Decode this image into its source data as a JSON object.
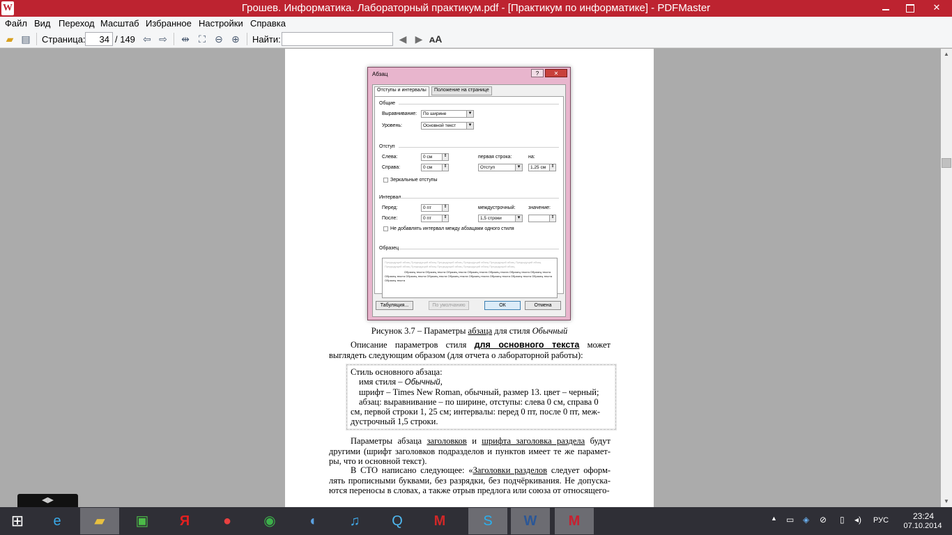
{
  "window": {
    "title": "Грошев. Информатика. Лабораторный практикум.pdf - [Практикум по информатике] - PDFMaster",
    "app_icon_glyph": "W"
  },
  "menu": [
    "Файл",
    "Вид",
    "Переход",
    "Масштаб",
    "Избранное",
    "Настройки",
    "Справка"
  ],
  "toolbar": {
    "page_label": "Страница:",
    "page_value": "34",
    "page_total": "/ 149",
    "find_label": "Найти:",
    "find_value": ""
  },
  "dialog": {
    "title": "Абзац",
    "tabs": [
      "Отступы и интервалы",
      "Положение на странице"
    ],
    "general_section": "Общие",
    "alignment_label": "Выравнивание:",
    "alignment_value": "По ширине",
    "level_label": "Уровень:",
    "level_value": "Основной текст",
    "indent_section": "Отступ",
    "left_label": "Слева:",
    "left_value": "0 см",
    "right_label": "Справа:",
    "right_value": "0 см",
    "first_line_label": "первая строка:",
    "first_line_value": "Отступ",
    "by_label": "на:",
    "by_value": "1,25 см",
    "mirror_label": "Зеркальные отступы",
    "spacing_section": "Интервал",
    "before_label": "Перед:",
    "before_value": "0 пт",
    "after_label": "После:",
    "after_value": "0 пт",
    "line_spacing_label": "междустрочный:",
    "line_spacing_value": "1,5 строки",
    "value_label": "значение:",
    "no_space_label": "Не добавлять интервал между абзацами одного стиля",
    "sample_section": "Образец",
    "sample_gray": "Предыдущий абзац Предыдущий абзац Предыдущий абзац Предыдущий абзац Предыдущий абзац Предыдущий абзац Предыдущий абзац Предыдущий абзац Предыдущий абзац Предыдущий абзац Предыдущий абзац",
    "sample_black": "Образец текста Образец текста Образец текста Образец текста Образец текста Образец текста Образец текста Образец текста Образец текста Образец текста Образец текста Образец текста Образец текста Образец текста Образец текста Образец текста",
    "btn_tabs": "Табуляция...",
    "btn_default": "По умолчанию",
    "btn_ok": "ОК",
    "btn_cancel": "Отмена"
  },
  "page": {
    "caption_prefix": "Рисунок 3.7 – Параметры ",
    "caption_link": "абзаца",
    "caption_mid": " для стиля ",
    "caption_italic": "Обычный",
    "para1_a": "Описание параметров стиля ",
    "para1_link": "для основного текста",
    "para1_b": " может выглядеть следующим образом (для отчета о лабораторной работы):",
    "box_line1": "Стиль основного абзаца:",
    "box_line2_a": "имя стиля – ",
    "box_line2_italic": "Обычный",
    "box_line2_b": ",",
    "box_line3": "шрифт – Times New Roman, обычный, размер 13. цвет – черный;",
    "box_line4": "абзац: выравнивание – по ширине, отступы: слева 0 см, справа  0",
    "box_line5": "см, первой строки 1, 25 см; интервалы: перед 0 пт, после 0 пт, меж-",
    "box_line6": "дустрочный 1,5 строки.",
    "para2_a": "Параметры абзаца ",
    "para2_link1": "заголовков",
    "para2_b": " и ",
    "para2_link2": "шрифта заголовка раздела",
    "para2_c": " будут другими (шрифт заголовков подразделов и пунктов имеет те же парамет-ры, что и основной текст).",
    "para3_a": "В СТО написано следующее: «",
    "para3_link": "Заголовки разделов",
    "para3_b": " следует оформ-лять прописными буквами, без разрядки, без подчёркивания. Не допуска-ются переносы в словах, а также отрыв предлога или союза от относящего-"
  },
  "taskbar": {
    "language": "РУС",
    "time": "23:24",
    "date": "07.10.2014"
  }
}
